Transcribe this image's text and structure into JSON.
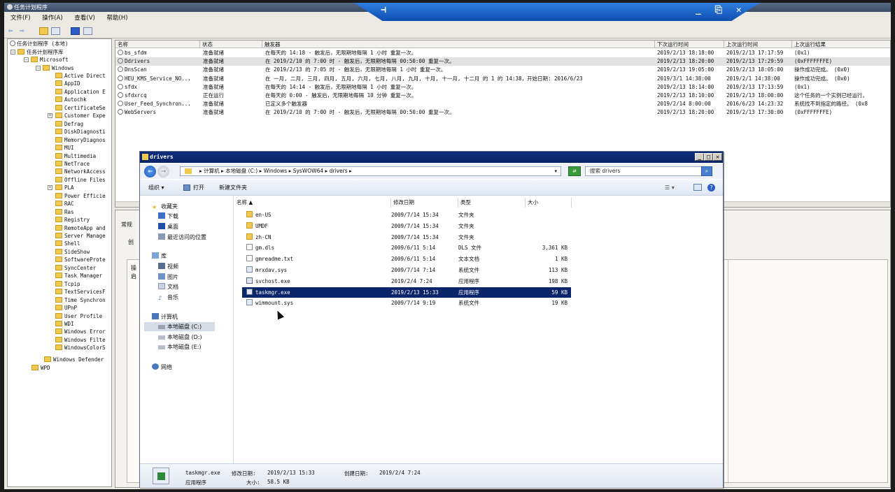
{
  "app": {
    "title": "任务计划程序"
  },
  "menu": [
    "文件(F)",
    "操作(A)",
    "查看(V)",
    "帮助(H)"
  ],
  "rdp_bar": {
    "pin": "⊣",
    "controls": "_ ⎘ ✕"
  },
  "tree": {
    "root": "任务计划程序 (本地)",
    "library": "任务计划程序库",
    "microsoft": "Microsoft",
    "windows": "Windows",
    "items": [
      "Active Direct",
      "AppID",
      "Application E",
      "Autochk",
      "CertificateSe",
      "Customer Expe",
      "Defrag",
      "DiskDiagnosti",
      "MemoryDiagnos",
      "MUI",
      "Multimedia",
      "NetTrace",
      "NetworkAccess",
      "Offline Files",
      "PLA",
      "Power Efficie",
      "RAC",
      "Ras",
      "Registry",
      "RemoteApp and",
      "Server Manage",
      "Shell",
      "SideShow",
      "SoftwareProte",
      "SyncCenter",
      "Task Manager",
      "Tcpip",
      "TextServicesF",
      "Time Synchron",
      "UPnP",
      "User Profile",
      "WDI",
      "Windows Error",
      "Windows Filte",
      "WindowsColorS"
    ],
    "defender": "Windows Defender",
    "wpd": "WPD"
  },
  "tasks": {
    "headers": [
      "名称",
      "状态",
      "触发器",
      "下次运行时间",
      "上次运行时间",
      "上次运行结果"
    ],
    "rows": [
      {
        "name": "bs_sfdm",
        "status": "准备就绪",
        "trigger": "在每天的 14:18 - 触发后，无限期地每隔 1 小时 重复一次。",
        "next": "2019/2/13 18:18:00",
        "last": "2019/2/13 17:17:59",
        "result": "(0x1)"
      },
      {
        "name": "Ddrivers",
        "status": "准备就绪",
        "trigger": "在 2019/2/10 的 7:00 时 - 触发后，无限期地每隔 00:50:00 重复一次。",
        "next": "2019/2/13 18:20:00",
        "last": "2019/2/13 17:29:59",
        "result": "(0xFFFFFFFE)"
      },
      {
        "name": "DnsScan",
        "status": "准备就绪",
        "trigger": "在 2019/2/13 的 7:05 时 - 触发后，无限期地每隔 1 小时 重复一次。",
        "next": "2019/2/13 19:05:00",
        "last": "2019/2/13 18:05:00",
        "result": "操作成功完成。 (0x0)"
      },
      {
        "name": "HEU_KMS_Service_NO...",
        "status": "准备就绪",
        "trigger": "在 一月, 二月, 三月, 四月, 五月, 六月, 七月, 八月, 九月, 十月, 十一月, 十二月 的 1 的 14:38，开始日期: 2016/6/23",
        "next": "2019/3/1 14:38:00",
        "last": "2019/2/1 14:38:00",
        "result": "操作成功完成。 (0x0)"
      },
      {
        "name": "sfdx",
        "status": "准备就绪",
        "trigger": "在每天的 14:14 - 触发后，无限期地每隔 1 小时 重复一次。",
        "next": "2019/2/13 18:14:00",
        "last": "2019/2/13 17:13:59",
        "result": "(0x1)"
      },
      {
        "name": "sfdxrcq",
        "status": "正在运行",
        "trigger": "在每天的 0:00 - 触发后，无限期地每隔 10 分钟 重复一次。",
        "next": "2019/2/13 18:10:00",
        "last": "2019/2/13 18:00:00",
        "result": "这个任务的一个实例已经运行。"
      },
      {
        "name": "User_Feed_Synchron...",
        "status": "准备就绪",
        "trigger": "已定义多个触发器",
        "next": "2019/2/14 8:00:00",
        "last": "2016/6/23 14:23:32",
        "result": "系统找不到指定的路径。 (0x8"
      },
      {
        "name": "WebServers",
        "status": "准备就绪",
        "trigger": "在 2019/2/10 的 7:00 时 - 触发后，无限期地每隔 00:50:00 重复一次。",
        "next": "2019/2/13 18:20:00",
        "last": "2019/2/13 17:30:00",
        "result": "(0xFFFFFFFE)"
      }
    ]
  },
  "lower_pane": {
    "tab": "常规",
    "label1": "创",
    "label2": "操",
    "label3": "启"
  },
  "explorer": {
    "title": "drivers",
    "address": "▸ 计算机 ▸ 本地磁盘 (C:) ▸ Windows ▸ SysWOW64 ▸ drivers ▸",
    "search_placeholder": "搜索 drivers",
    "cmd": {
      "organize": "组织 ▾",
      "open": "打开",
      "new_folder": "新建文件夹"
    },
    "nav": {
      "favorites": "收藏夹",
      "downloads": "下载",
      "desktop": "桌面",
      "recent": "最近访问的位置",
      "libraries": "库",
      "videos": "视频",
      "pictures": "图片",
      "documents": "文档",
      "music": "音乐",
      "computer": "计算机",
      "drive_c": "本地磁盘 (C:)",
      "drive_d": "本地磁盘 (D:)",
      "drive_e": "本地磁盘 (E:)",
      "network": "网络"
    },
    "columns": [
      "名称 ▲",
      "修改日期",
      "类型",
      "大小"
    ],
    "files": [
      {
        "name": "en-US",
        "date": "2009/7/14 15:34",
        "type": "文件夹",
        "size": "",
        "kind": "folder"
      },
      {
        "name": "UMDF",
        "date": "2009/7/14 15:34",
        "type": "文件夹",
        "size": "",
        "kind": "folder"
      },
      {
        "name": "zh-CN",
        "date": "2009/7/14 15:34",
        "type": "文件夹",
        "size": "",
        "kind": "folder"
      },
      {
        "name": "gm.dls",
        "date": "2009/6/11 5:14",
        "type": "DLS 文件",
        "size": "3,361 KB",
        "kind": "file"
      },
      {
        "name": "gmreadme.txt",
        "date": "2009/6/11 5:14",
        "type": "文本文档",
        "size": "1 KB",
        "kind": "file"
      },
      {
        "name": "mrxdav.sys",
        "date": "2009/7/14 7:14",
        "type": "系统文件",
        "size": "113 KB",
        "kind": "sys"
      },
      {
        "name": "svchost.exe",
        "date": "2019/2/4 7:24",
        "type": "应用程序",
        "size": "198 KB",
        "kind": "exe"
      },
      {
        "name": "taskmgr.exe",
        "date": "2019/2/13 15:33",
        "type": "应用程序",
        "size": "59 KB",
        "kind": "exe",
        "selected": true
      },
      {
        "name": "wimmount.sys",
        "date": "2009/7/14 9:19",
        "type": "系统文件",
        "size": "19 KB",
        "kind": "sys"
      }
    ],
    "details": {
      "filename": "taskmgr.exe",
      "modified_label": "修改日期:",
      "modified": "2019/2/13 15:33",
      "created_label": "创建日期:",
      "created": "2019/2/4 7:24",
      "type": "应用程序",
      "size_label": "大小:",
      "size": "58.5 KB"
    }
  },
  "colors": {
    "selection": "#0b256b",
    "title_gradient_top": "#0c2c7a",
    "rdp_blue": "#1a5fd0"
  }
}
